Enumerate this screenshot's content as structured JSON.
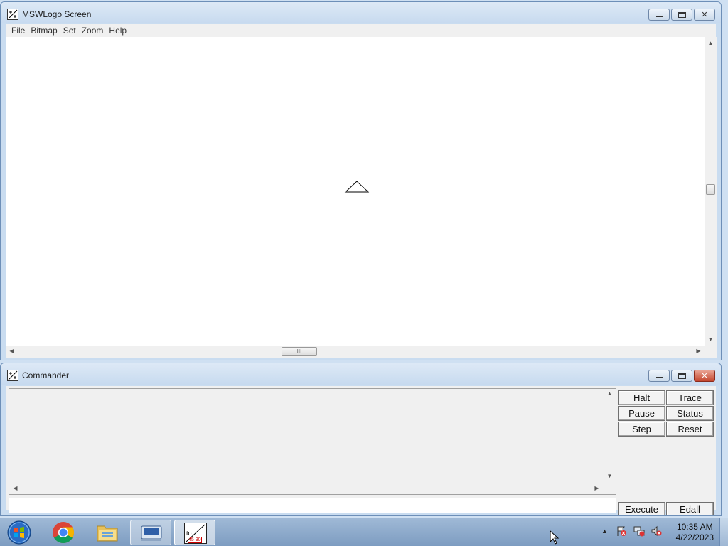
{
  "screen_window": {
    "title": "MSWLogo Screen",
    "menu": [
      "File",
      "Bitmap",
      "Set",
      "Zoom",
      "Help"
    ],
    "hscroll_thumb_label": "III"
  },
  "commander_window": {
    "title": "Commander",
    "buttons": {
      "halt": "Halt",
      "trace": "Trace",
      "pause": "Pause",
      "status": "Status",
      "step": "Step",
      "reset": "Reset",
      "execute": "Execute",
      "edall": "Edall"
    },
    "input_value": ""
  },
  "taskbar": {
    "apps": [
      "start-orb",
      "chrome",
      "file-explorer",
      "on-screen-keyboard",
      "mswlogo"
    ],
    "mswlogo_icon_text": "to",
    "mswlogo_icon_sub": "45 90",
    "clock": {
      "time": "10:35 AM",
      "date": "4/22/2023"
    }
  },
  "colors": {
    "accent": "#c9dcf0",
    "close_red": "#c4472e",
    "taskbar": "#8aa8cc"
  }
}
